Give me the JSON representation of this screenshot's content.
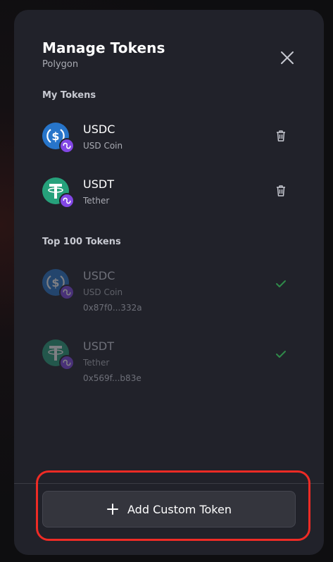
{
  "header": {
    "title": "Manage Tokens",
    "network": "Polygon",
    "close_icon": "close-icon"
  },
  "my_tokens": {
    "label": "My Tokens",
    "items": [
      {
        "symbol": "USDC",
        "name": "USD Coin",
        "icon": "usdc-icon",
        "badge": "polygon-icon",
        "color": "#2775ca"
      },
      {
        "symbol": "USDT",
        "name": "Tether",
        "icon": "usdt-icon",
        "badge": "polygon-icon",
        "color": "#26a17b"
      }
    ]
  },
  "top_tokens": {
    "label": "Top 100 Tokens",
    "items": [
      {
        "symbol": "USDC",
        "name": "USD Coin",
        "address": "0x87f0...332a",
        "added": true
      },
      {
        "symbol": "USDT",
        "name": "Tether",
        "address": "0x569f...b83e",
        "added": true
      }
    ]
  },
  "footer": {
    "add_button_label": "Add Custom Token",
    "plus_icon": "plus-icon"
  },
  "colors": {
    "modal_bg": "#21222a",
    "polygon_purple": "#8247e5",
    "check_green": "#2f8a4a",
    "highlight_red": "#ef2b25"
  }
}
